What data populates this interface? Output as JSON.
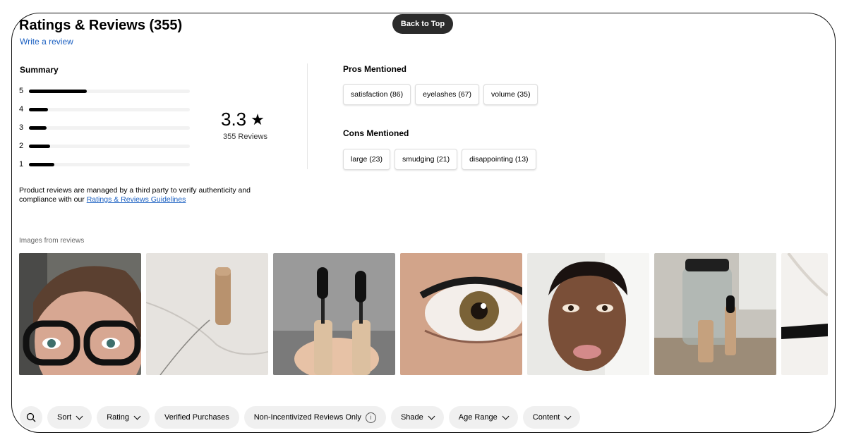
{
  "back_to_top": "Back to Top",
  "header": {
    "title": "Ratings & Reviews (355)",
    "write_review": "Write a review"
  },
  "summary": {
    "label": "Summary",
    "distribution": [
      {
        "star": "5",
        "fraction": 0.36
      },
      {
        "star": "4",
        "fraction": 0.12
      },
      {
        "star": "3",
        "fraction": 0.11
      },
      {
        "star": "2",
        "fraction": 0.13
      },
      {
        "star": "1",
        "fraction": 0.16
      }
    ],
    "average": "3.3",
    "star_glyph": "★",
    "review_count": "355 Reviews"
  },
  "disclaimer": {
    "text": "Product reviews are managed by a third party to verify authenticity and compliance with our ",
    "link": "Ratings & Reviews Guidelines"
  },
  "pros": {
    "label": "Pros Mentioned",
    "items": [
      "satisfaction (86)",
      "eyelashes (67)",
      "volume (35)"
    ]
  },
  "cons": {
    "label": "Cons Mentioned",
    "items": [
      "large (23)",
      "smudging (21)",
      "disappointing (13)"
    ]
  },
  "images": {
    "label": "Images from reviews",
    "thumbnails": [
      "review-image-woman-glasses",
      "review-image-mascara-tube-marble",
      "review-image-mascara-wands",
      "review-image-eye-closeup",
      "review-image-man-face",
      "review-image-bathroom-counter",
      "review-image-mascara-swatch"
    ]
  },
  "filters": {
    "search_icon": "search-icon",
    "sort": "Sort",
    "rating": "Rating",
    "verified": "Verified Purchases",
    "non_incentivized": "Non-Incentivized Reviews Only",
    "info_icon": "i",
    "shade": "Shade",
    "age_range": "Age Range",
    "content": "Content"
  }
}
